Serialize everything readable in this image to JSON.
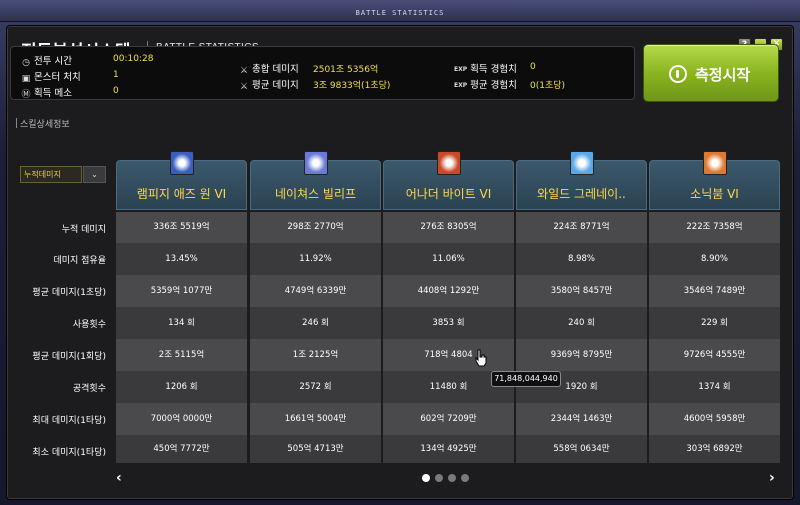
{
  "window": {
    "top_title": "BATTLE STATISTICS",
    "title": "전투분석시스템",
    "subtitle": "BATTLE STATISTICS",
    "help_label": "?"
  },
  "stats": {
    "battle_time": {
      "label": "전투 시간",
      "value": "00:10:28"
    },
    "monsters": {
      "label": "몬스터 처치",
      "value": "1"
    },
    "meso": {
      "label": "획득 메소",
      "value": "0"
    },
    "total_damage": {
      "label": "총합 데미지",
      "value": "2501조 5356억"
    },
    "avg_damage": {
      "label": "평균 데미지",
      "value": "3조 9833억(1초당)"
    },
    "exp_gained": {
      "prefix": "EXP",
      "label": "획득 경험치",
      "value": "0"
    },
    "exp_avg": {
      "prefix": "EXP",
      "label": "평균 경험치",
      "value": "0(1초당)"
    }
  },
  "start_button": {
    "label": "측정시작"
  },
  "section": {
    "label": "스킬상세정보"
  },
  "dropdown": {
    "selected": "누적데미지",
    "arrow": "⌄"
  },
  "row_labels": [
    "누적 데미지",
    "데미지 점유율",
    "평균 데미지(1초당)",
    "사용횟수",
    "평균 데미지(1회당)",
    "공격횟수",
    "최대 데미지(1타당)",
    "최소 데미지(1타당)"
  ],
  "skills": [
    {
      "name": "램피지 애즈 원 VI",
      "icon_color": "#3a5ec0",
      "values": [
        "336조 5519억",
        "13.45%",
        "5359억 1077만",
        "134 회",
        "2조 5115억",
        "1206 회",
        "7000억 0000만",
        "450억 7772만"
      ]
    },
    {
      "name": "네이쳐스 빌리프",
      "icon_color": "#6a7ad8",
      "values": [
        "298조 2770억",
        "11.92%",
        "4749억 6339만",
        "246 회",
        "1조 2125억",
        "2572 회",
        "1661억 5004만",
        "505억 4713만"
      ]
    },
    {
      "name": "어나더 바이트 VI",
      "icon_color": "#c84a2a",
      "values": [
        "276조 8305억",
        "11.06%",
        "4408억 1292만",
        "3853 회",
        "718억 4804",
        "11480 회",
        "602억 7209만",
        "134억 4925만"
      ]
    },
    {
      "name": "와일드 그레네이..",
      "icon_color": "#5aa8e8",
      "values": [
        "224조 8771억",
        "8.98%",
        "3580억 8457만",
        "240 회",
        "9369억 8795만",
        "1920 회",
        "2344억 1463만",
        "558억 0634만"
      ]
    },
    {
      "name": "소닉붐 VI",
      "icon_color": "#e07a30",
      "values": [
        "222조 7358억",
        "8.90%",
        "3546억 7489만",
        "229 회",
        "9726억 4555만",
        "1374 회",
        "4600억 5958만",
        "303억 6892만"
      ]
    }
  ],
  "tooltip": {
    "text": "71,848,044,940"
  },
  "pager": {
    "prev": "‹",
    "next": "›",
    "pages": 4,
    "current": 1
  },
  "colors": {
    "accent_yellow": "#ffd84a",
    "value_yellow": "#f0e040",
    "start_green": "#8ab51f"
  }
}
